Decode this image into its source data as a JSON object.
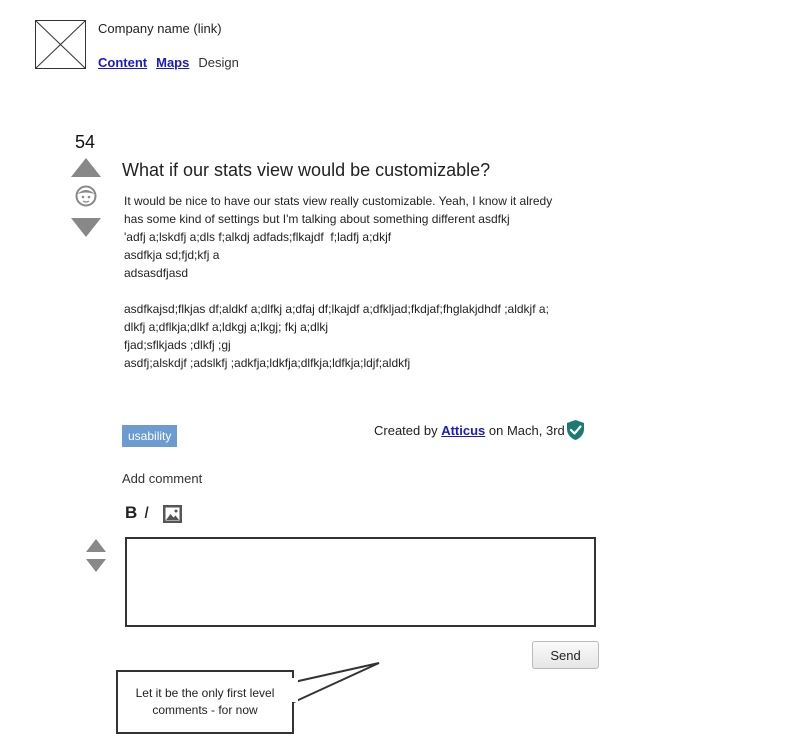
{
  "header": {
    "company_link": "Company name (link)",
    "nav": [
      {
        "label": "Content"
      },
      {
        "label": "Maps"
      },
      {
        "label": "Design"
      }
    ]
  },
  "question": {
    "votes": "54",
    "title": "What if our stats view would be customizable?",
    "body_lines": [
      "It would be nice to have our stats view really customizable. Yeah, I know it alredy",
      "has some kind of settings but I'm talking about something different asdfkj",
      "'adfj a;lskdfj a;dls f;alkdj adfads;flkajdf  f;ladfj a;dkjf",
      "asdfkja sd;fjd;kfj a",
      "adsasdfjasd",
      "",
      "asdfkajsd;flkjas df;aldkf a;dlfkj a;dfaj df;lkajdf a;dfkljad;fkdjaf;fhglakjdhdf ;aldkjf a;",
      "dlkfj a;dflkja;dlkf a;ldkgj a;lkgj; fkj a;dlkj",
      "fjad;sflkjads ;dlkfj ;gj",
      "asdfj;alskdjf ;adslkfj ;adkfja;ldkfja;dlfkja;ldfkja;ldjf;aldkfj"
    ],
    "tag": "usability",
    "created_prefix": "Created by",
    "author": "Atticus",
    "created_suffix": "on Mach, 3rd",
    "verified_icon": "shield-check-icon"
  },
  "comment": {
    "add_label": "Add comment",
    "bold_label": "B",
    "italic_label": "I",
    "input_value": "",
    "send_label": "Send"
  },
  "callout": {
    "text": "Let it be the only first level comments - for now"
  },
  "colors": {
    "link": "#1a1ac8",
    "tag_bg": "#6b9bd0",
    "arrow": "#888888",
    "verified": "#1b7b70"
  }
}
